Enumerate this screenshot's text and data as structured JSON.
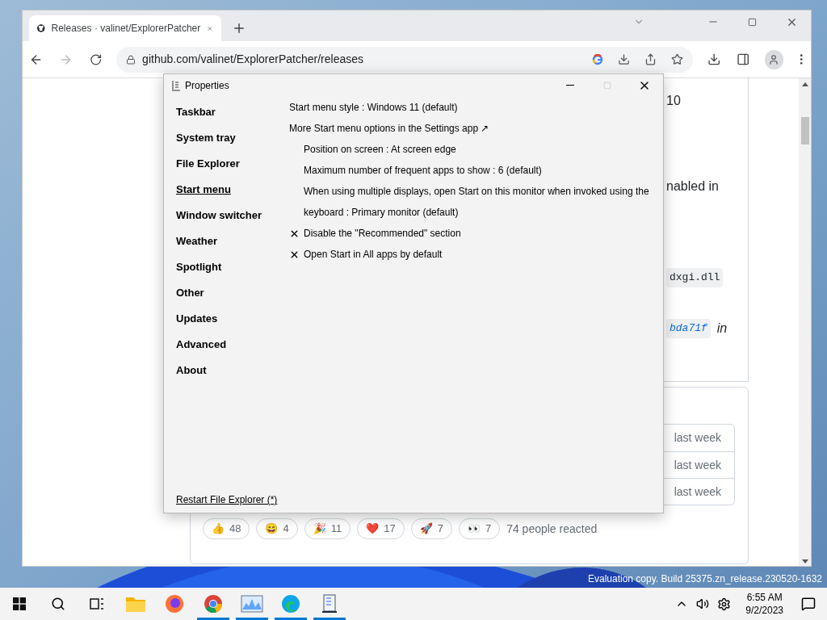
{
  "browser": {
    "tab": {
      "title": "Releases · valinet/ExplorerPatcher"
    },
    "url": "github.com/valinet/ExplorerPatcher/releases"
  },
  "page": {
    "fragments": [
      {
        "kind": "text",
        "text": "10"
      },
      {
        "kind": "text",
        "text": "nabled in"
      },
      {
        "kind": "code",
        "text": "dxgi.dll"
      },
      {
        "kind": "commit",
        "text": "bda71f",
        "after": "in"
      }
    ],
    "assets_times": [
      "last week",
      "last week",
      "last week"
    ],
    "reactions": [
      {
        "emoji": "👍",
        "count": "48"
      },
      {
        "emoji": "😄",
        "count": "4"
      },
      {
        "emoji": "🎉",
        "count": "11"
      },
      {
        "emoji": "❤️",
        "count": "17"
      },
      {
        "emoji": "🚀",
        "count": "7"
      },
      {
        "emoji": "👀",
        "count": "7"
      }
    ],
    "reactions_summary": "74 people reacted"
  },
  "dialog": {
    "title": "Properties",
    "sidebar": [
      {
        "label": "Taskbar",
        "selected": false
      },
      {
        "label": "System tray",
        "selected": false
      },
      {
        "label": "File Explorer",
        "selected": false
      },
      {
        "label": "Start menu",
        "selected": true
      },
      {
        "label": "Window switcher",
        "selected": false
      },
      {
        "label": "Weather",
        "selected": false
      },
      {
        "label": "Spotlight",
        "selected": false
      },
      {
        "label": "Other",
        "selected": false
      },
      {
        "label": "Updates",
        "selected": false
      },
      {
        "label": "Advanced",
        "selected": false
      },
      {
        "label": "About",
        "selected": false
      }
    ],
    "settings": [
      {
        "kind": "option",
        "text": "Start menu style : Windows 11 (default)"
      },
      {
        "kind": "link",
        "text": "More Start menu options in the Settings app ↗",
        "children": [
          {
            "kind": "option",
            "text": "Position on screen : At screen edge"
          },
          {
            "kind": "option",
            "text": "Maximum number of frequent apps to show : 6 (default)"
          },
          {
            "kind": "option",
            "text": "When using multiple displays, open Start on this monitor when invoked using the keyboard : Primary monitor (default)"
          }
        ]
      },
      {
        "kind": "toggle",
        "text": "Disable the \"Recommended\" section",
        "checked": false
      },
      {
        "kind": "toggle",
        "text": "Open Start in All apps by default",
        "checked": false
      }
    ],
    "footer_link": "Restart File Explorer (*)"
  },
  "desktop": {
    "watermark": "Evaluation copy. Build 25375.zn_release.230520-1632"
  },
  "taskbar": {
    "apps": [
      {
        "kind": "folder",
        "running": false
      },
      {
        "kind": "firefox",
        "running": false
      },
      {
        "kind": "chrome",
        "running": true
      },
      {
        "kind": "monitor",
        "running": true
      },
      {
        "kind": "edge",
        "running": true
      },
      {
        "kind": "patcher",
        "running": true
      }
    ],
    "time": "6:55 AM",
    "date": "9/2/2023"
  }
}
